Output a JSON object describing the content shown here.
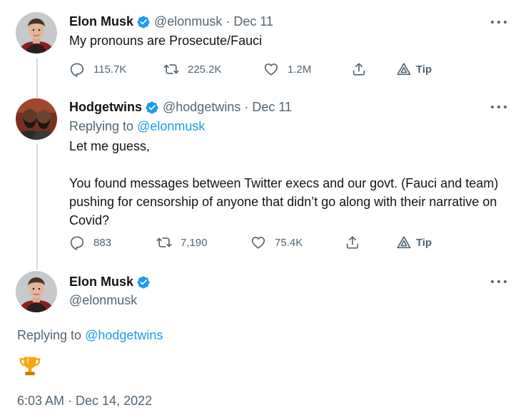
{
  "tweets": [
    {
      "author_name": "Elon Musk",
      "handle": "@elonmusk",
      "separator": "·",
      "date": "Dec 11",
      "text": "My pronouns are Prosecute/Fauci",
      "stats": {
        "replies": "115.7K",
        "retweets": "225.2K",
        "likes": "1.2M",
        "tip": "Tip"
      }
    },
    {
      "author_name": "Hodgetwins",
      "handle": "@hodgetwins",
      "separator": "·",
      "date": "Dec 11",
      "replying_prefix": "Replying to ",
      "replying_handle": "@elonmusk",
      "text": "Let me guess,\n\nYou found messages between Twitter execs and our govt. (Fauci and team)\npushing for censorship of anyone that didn’t go along with their narrative on\nCovid?",
      "stats": {
        "replies": "883",
        "retweets": "7,190",
        "likes": "75.4K",
        "tip": "Tip"
      }
    }
  ],
  "main_tweet": {
    "author_name": "Elon Musk",
    "handle": "@elonmusk",
    "replying_prefix": "Replying to ",
    "replying_handle": "@hodgetwins",
    "emoji": "trophy",
    "timestamp": "6:03 AM · Dec 14, 2022"
  },
  "colors": {
    "verified": "#1d9bf0",
    "link": "#1d9bf0",
    "secondary_text": "#536471",
    "thread_line": "#cfd9de",
    "trophy": "#f4a70f"
  }
}
